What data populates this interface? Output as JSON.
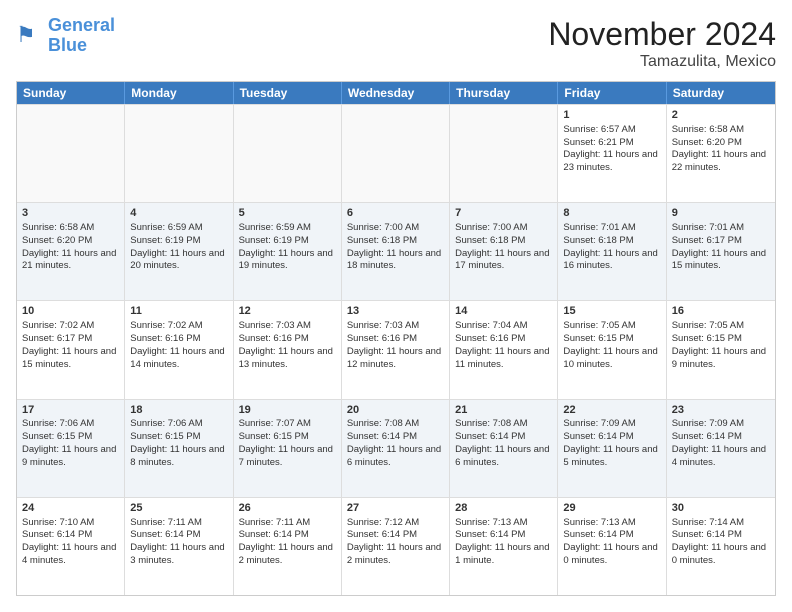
{
  "logo": {
    "line1": "General",
    "line2": "Blue"
  },
  "title": "November 2024",
  "subtitle": "Tamazulita, Mexico",
  "headers": [
    "Sunday",
    "Monday",
    "Tuesday",
    "Wednesday",
    "Thursday",
    "Friday",
    "Saturday"
  ],
  "rows": [
    [
      {
        "day": "",
        "text": "",
        "empty": true
      },
      {
        "day": "",
        "text": "",
        "empty": true
      },
      {
        "day": "",
        "text": "",
        "empty": true
      },
      {
        "day": "",
        "text": "",
        "empty": true
      },
      {
        "day": "",
        "text": "",
        "empty": true
      },
      {
        "day": "1",
        "text": "Sunrise: 6:57 AM\nSunset: 6:21 PM\nDaylight: 11 hours and 23 minutes."
      },
      {
        "day": "2",
        "text": "Sunrise: 6:58 AM\nSunset: 6:20 PM\nDaylight: 11 hours and 22 minutes."
      }
    ],
    [
      {
        "day": "3",
        "text": "Sunrise: 6:58 AM\nSunset: 6:20 PM\nDaylight: 11 hours and 21 minutes."
      },
      {
        "day": "4",
        "text": "Sunrise: 6:59 AM\nSunset: 6:19 PM\nDaylight: 11 hours and 20 minutes."
      },
      {
        "day": "5",
        "text": "Sunrise: 6:59 AM\nSunset: 6:19 PM\nDaylight: 11 hours and 19 minutes."
      },
      {
        "day": "6",
        "text": "Sunrise: 7:00 AM\nSunset: 6:18 PM\nDaylight: 11 hours and 18 minutes."
      },
      {
        "day": "7",
        "text": "Sunrise: 7:00 AM\nSunset: 6:18 PM\nDaylight: 11 hours and 17 minutes."
      },
      {
        "day": "8",
        "text": "Sunrise: 7:01 AM\nSunset: 6:18 PM\nDaylight: 11 hours and 16 minutes."
      },
      {
        "day": "9",
        "text": "Sunrise: 7:01 AM\nSunset: 6:17 PM\nDaylight: 11 hours and 15 minutes."
      }
    ],
    [
      {
        "day": "10",
        "text": "Sunrise: 7:02 AM\nSunset: 6:17 PM\nDaylight: 11 hours and 15 minutes."
      },
      {
        "day": "11",
        "text": "Sunrise: 7:02 AM\nSunset: 6:16 PM\nDaylight: 11 hours and 14 minutes."
      },
      {
        "day": "12",
        "text": "Sunrise: 7:03 AM\nSunset: 6:16 PM\nDaylight: 11 hours and 13 minutes."
      },
      {
        "day": "13",
        "text": "Sunrise: 7:03 AM\nSunset: 6:16 PM\nDaylight: 11 hours and 12 minutes."
      },
      {
        "day": "14",
        "text": "Sunrise: 7:04 AM\nSunset: 6:16 PM\nDaylight: 11 hours and 11 minutes."
      },
      {
        "day": "15",
        "text": "Sunrise: 7:05 AM\nSunset: 6:15 PM\nDaylight: 11 hours and 10 minutes."
      },
      {
        "day": "16",
        "text": "Sunrise: 7:05 AM\nSunset: 6:15 PM\nDaylight: 11 hours and 9 minutes."
      }
    ],
    [
      {
        "day": "17",
        "text": "Sunrise: 7:06 AM\nSunset: 6:15 PM\nDaylight: 11 hours and 9 minutes."
      },
      {
        "day": "18",
        "text": "Sunrise: 7:06 AM\nSunset: 6:15 PM\nDaylight: 11 hours and 8 minutes."
      },
      {
        "day": "19",
        "text": "Sunrise: 7:07 AM\nSunset: 6:15 PM\nDaylight: 11 hours and 7 minutes."
      },
      {
        "day": "20",
        "text": "Sunrise: 7:08 AM\nSunset: 6:14 PM\nDaylight: 11 hours and 6 minutes."
      },
      {
        "day": "21",
        "text": "Sunrise: 7:08 AM\nSunset: 6:14 PM\nDaylight: 11 hours and 6 minutes."
      },
      {
        "day": "22",
        "text": "Sunrise: 7:09 AM\nSunset: 6:14 PM\nDaylight: 11 hours and 5 minutes."
      },
      {
        "day": "23",
        "text": "Sunrise: 7:09 AM\nSunset: 6:14 PM\nDaylight: 11 hours and 4 minutes."
      }
    ],
    [
      {
        "day": "24",
        "text": "Sunrise: 7:10 AM\nSunset: 6:14 PM\nDaylight: 11 hours and 4 minutes."
      },
      {
        "day": "25",
        "text": "Sunrise: 7:11 AM\nSunset: 6:14 PM\nDaylight: 11 hours and 3 minutes."
      },
      {
        "day": "26",
        "text": "Sunrise: 7:11 AM\nSunset: 6:14 PM\nDaylight: 11 hours and 2 minutes."
      },
      {
        "day": "27",
        "text": "Sunrise: 7:12 AM\nSunset: 6:14 PM\nDaylight: 11 hours and 2 minutes."
      },
      {
        "day": "28",
        "text": "Sunrise: 7:13 AM\nSunset: 6:14 PM\nDaylight: 11 hours and 1 minute."
      },
      {
        "day": "29",
        "text": "Sunrise: 7:13 AM\nSunset: 6:14 PM\nDaylight: 11 hours and 0 minutes."
      },
      {
        "day": "30",
        "text": "Sunrise: 7:14 AM\nSunset: 6:14 PM\nDaylight: 11 hours and 0 minutes."
      }
    ]
  ]
}
